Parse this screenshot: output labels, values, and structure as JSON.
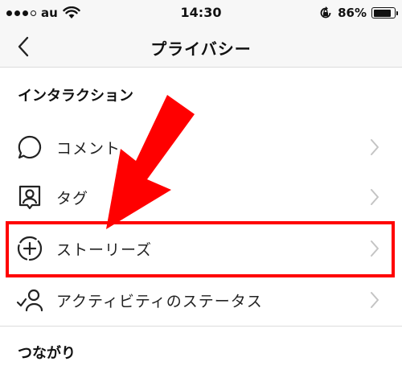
{
  "status_bar": {
    "carrier": "au",
    "time": "14:30",
    "battery_percent": "86%",
    "battery_level": 0.86,
    "icons": [
      "signal-dots-icon",
      "wifi-icon",
      "orientation-lock-icon",
      "battery-icon"
    ]
  },
  "nav": {
    "title": "プライバシー",
    "back_icon": "chevron-left-icon"
  },
  "sections": {
    "interactions": {
      "header": "インタラクション",
      "items": [
        {
          "label": "コメント",
          "icon": "comment-bubble-icon"
        },
        {
          "label": "タグ",
          "icon": "tag-person-icon"
        },
        {
          "label": "ストーリーズ",
          "icon": "story-add-icon"
        },
        {
          "label": "アクティビティのステータス",
          "icon": "activity-status-icon"
        }
      ]
    },
    "connections": {
      "header": "つながり"
    }
  },
  "annotation": {
    "highlight_color": "#ff0000",
    "highlighted_item": "ストーリーズ"
  }
}
